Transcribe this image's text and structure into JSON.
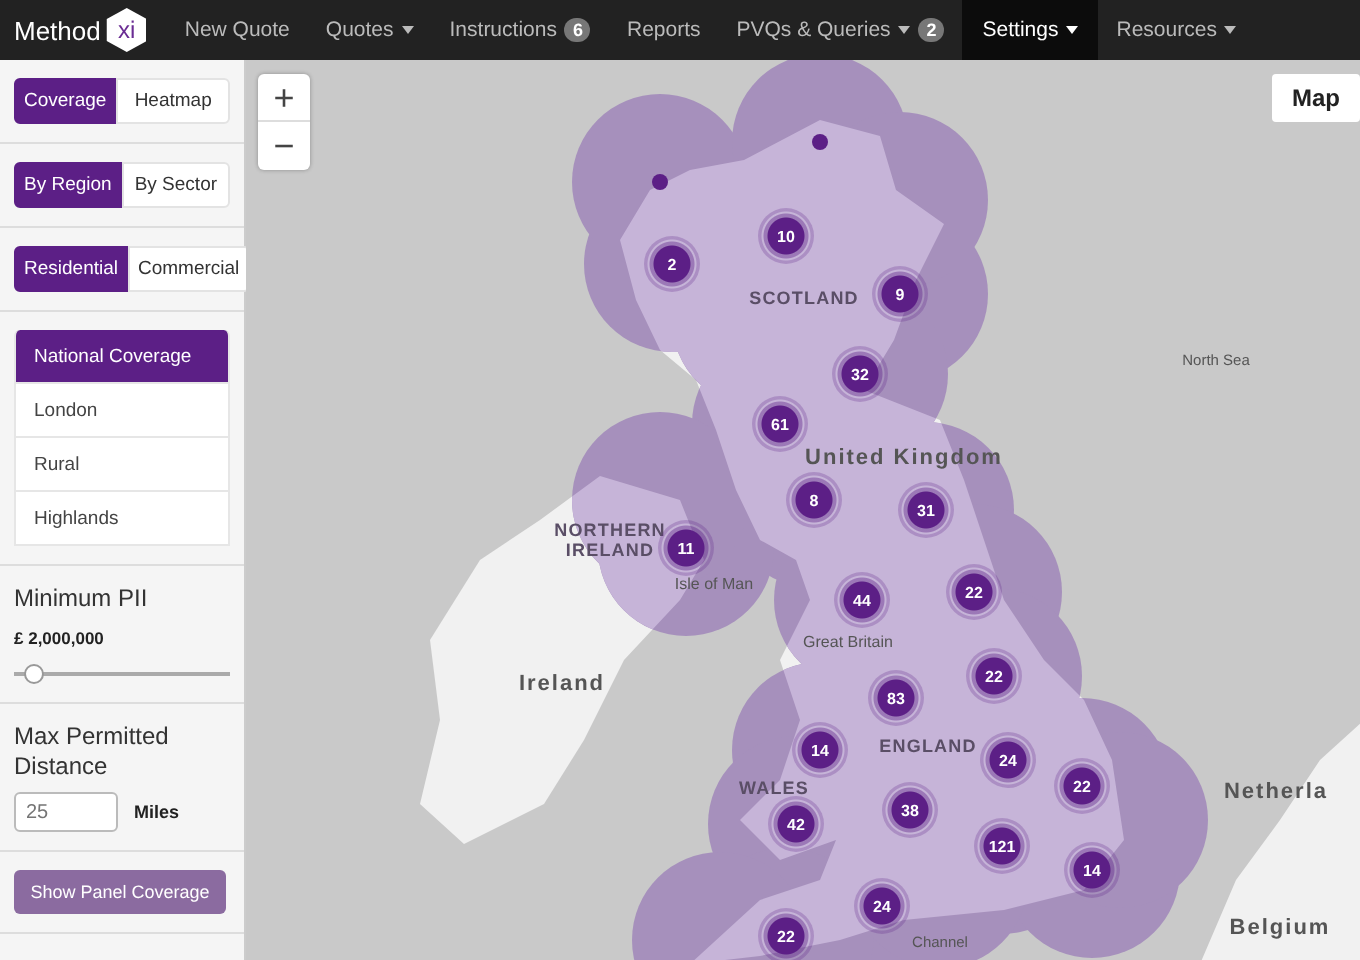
{
  "nav": {
    "brand": "Method",
    "logo": "xi",
    "items": [
      {
        "label": "New Quote",
        "caret": false,
        "selected": false
      },
      {
        "label": "Quotes",
        "caret": true,
        "selected": false
      },
      {
        "label": "Instructions",
        "caret": false,
        "badge": "6",
        "selected": false
      },
      {
        "label": "Reports",
        "caret": false,
        "selected": false
      },
      {
        "label": "PVQs & Queries",
        "caret": true,
        "badge": "2",
        "selected": false
      },
      {
        "label": "Settings",
        "caret": true,
        "selected": true
      },
      {
        "label": "Resources",
        "caret": true,
        "selected": false
      }
    ]
  },
  "sidebar": {
    "toggles": [
      [
        {
          "label": "Coverage",
          "selected": true
        },
        {
          "label": "Heatmap",
          "selected": false
        }
      ],
      [
        {
          "label": "By Region",
          "selected": true
        },
        {
          "label": "By Sector",
          "selected": false
        }
      ],
      [
        {
          "label": "Residential",
          "selected": true
        },
        {
          "label": "Commercial",
          "selected": false
        }
      ]
    ],
    "regions": [
      {
        "label": "National Coverage",
        "selected": true
      },
      {
        "label": "London",
        "selected": false
      },
      {
        "label": "Rural",
        "selected": false
      },
      {
        "label": "Highlands",
        "selected": false
      }
    ],
    "pii": {
      "title": "Minimum PII",
      "value": "£ 2,000,000",
      "level": 0.05
    },
    "distance": {
      "title": "Max Permitted Distance",
      "placeholder": "25",
      "unit": "Miles"
    },
    "button": "Show Panel Coverage"
  },
  "map": {
    "zoom_in": "+",
    "zoom_out": "−",
    "type_button": "Map",
    "labels": [
      {
        "text": "SCOTLAND",
        "kind": "region"
      },
      {
        "text": "United Kingdom",
        "kind": "country"
      },
      {
        "text": "NORTHERN IRELAND",
        "kind": "region"
      },
      {
        "text": "Isle of Man",
        "kind": "place"
      },
      {
        "text": "Ireland",
        "kind": "country"
      },
      {
        "text": "Great Britain",
        "kind": "place"
      },
      {
        "text": "ENGLAND",
        "kind": "region"
      },
      {
        "text": "WALES",
        "kind": "region"
      },
      {
        "text": "North Sea",
        "kind": "sea"
      },
      {
        "text": "Netherla",
        "kind": "country"
      },
      {
        "text": "Belgium",
        "kind": "country"
      },
      {
        "text": "Channel",
        "kind": "sea"
      }
    ],
    "clusters": [
      "10",
      "2",
      "9",
      "32",
      "61",
      "8",
      "31",
      "11",
      "44",
      "22",
      "22",
      "83",
      "14",
      "24",
      "22",
      "42",
      "38",
      "121",
      "14",
      "24",
      "22"
    ]
  }
}
